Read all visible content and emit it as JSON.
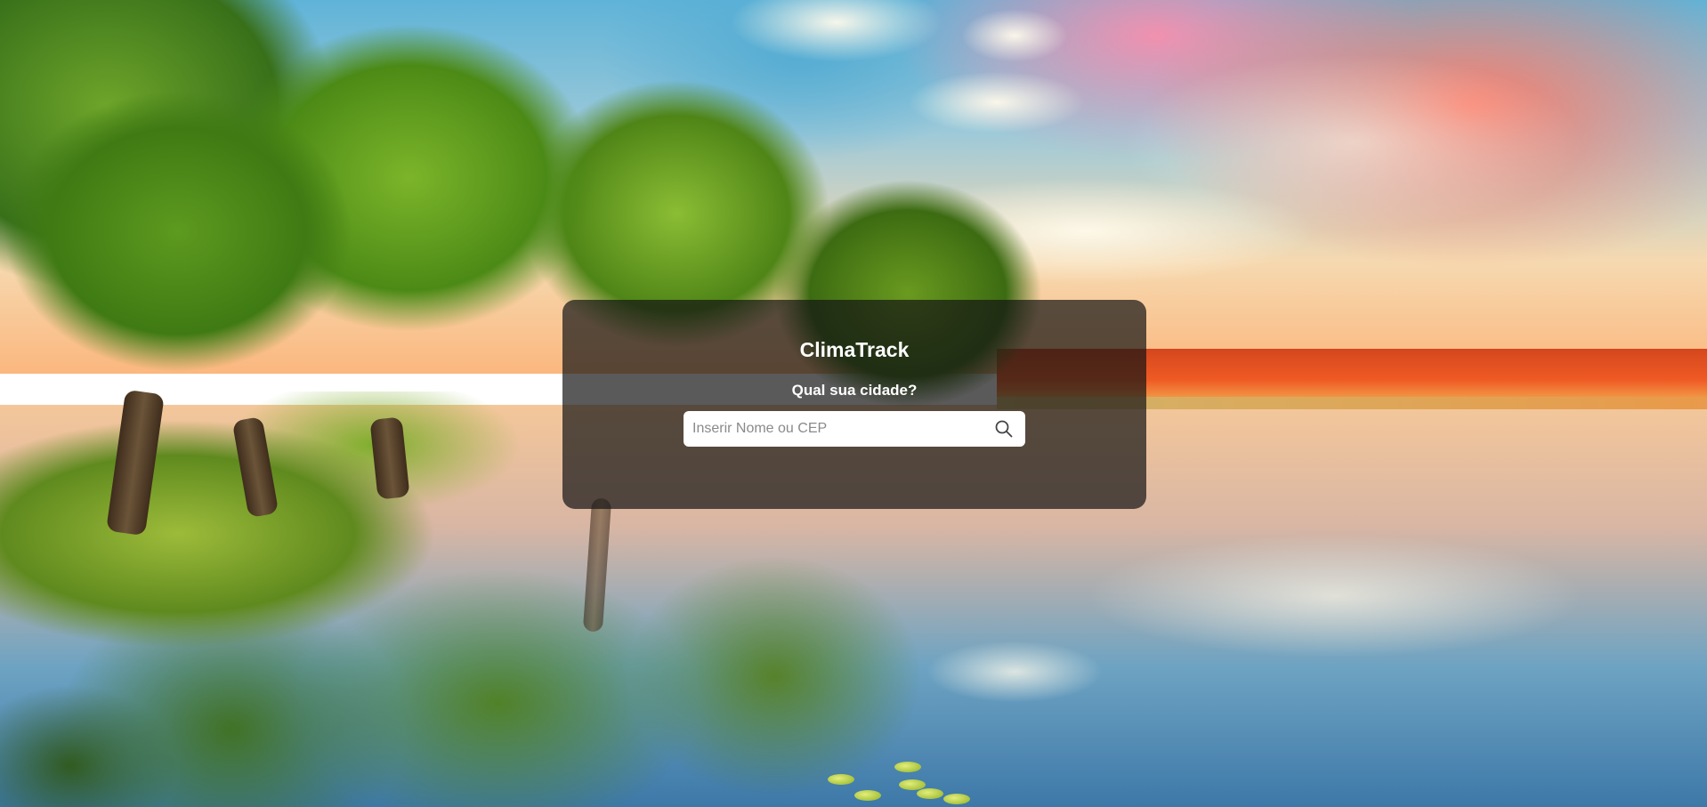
{
  "app": {
    "title": "ClimaTrack"
  },
  "search": {
    "prompt": "Qual sua cidade?",
    "placeholder": "Inserir Nome ou CEP",
    "value": "",
    "button_icon": "search-icon"
  },
  "colors": {
    "card_background": "#141414",
    "text": "#ffffff",
    "input_background": "#ffffff",
    "placeholder": "#8a8a8a"
  },
  "background": {
    "description_icon": "landscape-photo"
  }
}
